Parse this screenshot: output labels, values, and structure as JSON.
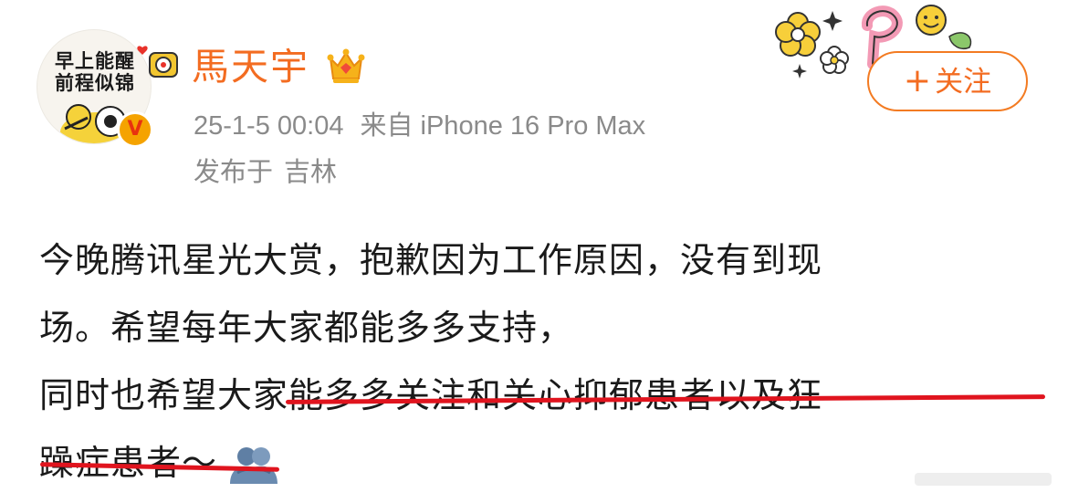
{
  "post": {
    "avatar_text_line1": "早上能醒",
    "avatar_text_line2": "前程似锦",
    "verified_badge": "V",
    "username": "馬天宇",
    "timestamp": "25-1-5 00:04",
    "source": "来自 iPhone 16 Pro Max",
    "location_prefix": "发布于",
    "location": "吉林",
    "follow_button": {
      "plus": "+",
      "label": "关注"
    },
    "content_lines": [
      "今晚腾讯星光大赏，抱歉因为工作原因，没有到现",
      "场。希望每年大家都能多多支持，",
      "同时也希望大家能多多关注和关心抑郁患者以及狂",
      "躁症患者～"
    ],
    "icons": {
      "crown": "crown-icon",
      "hug": "hug-emoji-icon",
      "verified": "verified-badge-icon"
    },
    "colors": {
      "username": "#f36c21",
      "meta": "#8a8a8a",
      "underline": "#e0141e",
      "follow_border": "#f37b22"
    }
  }
}
